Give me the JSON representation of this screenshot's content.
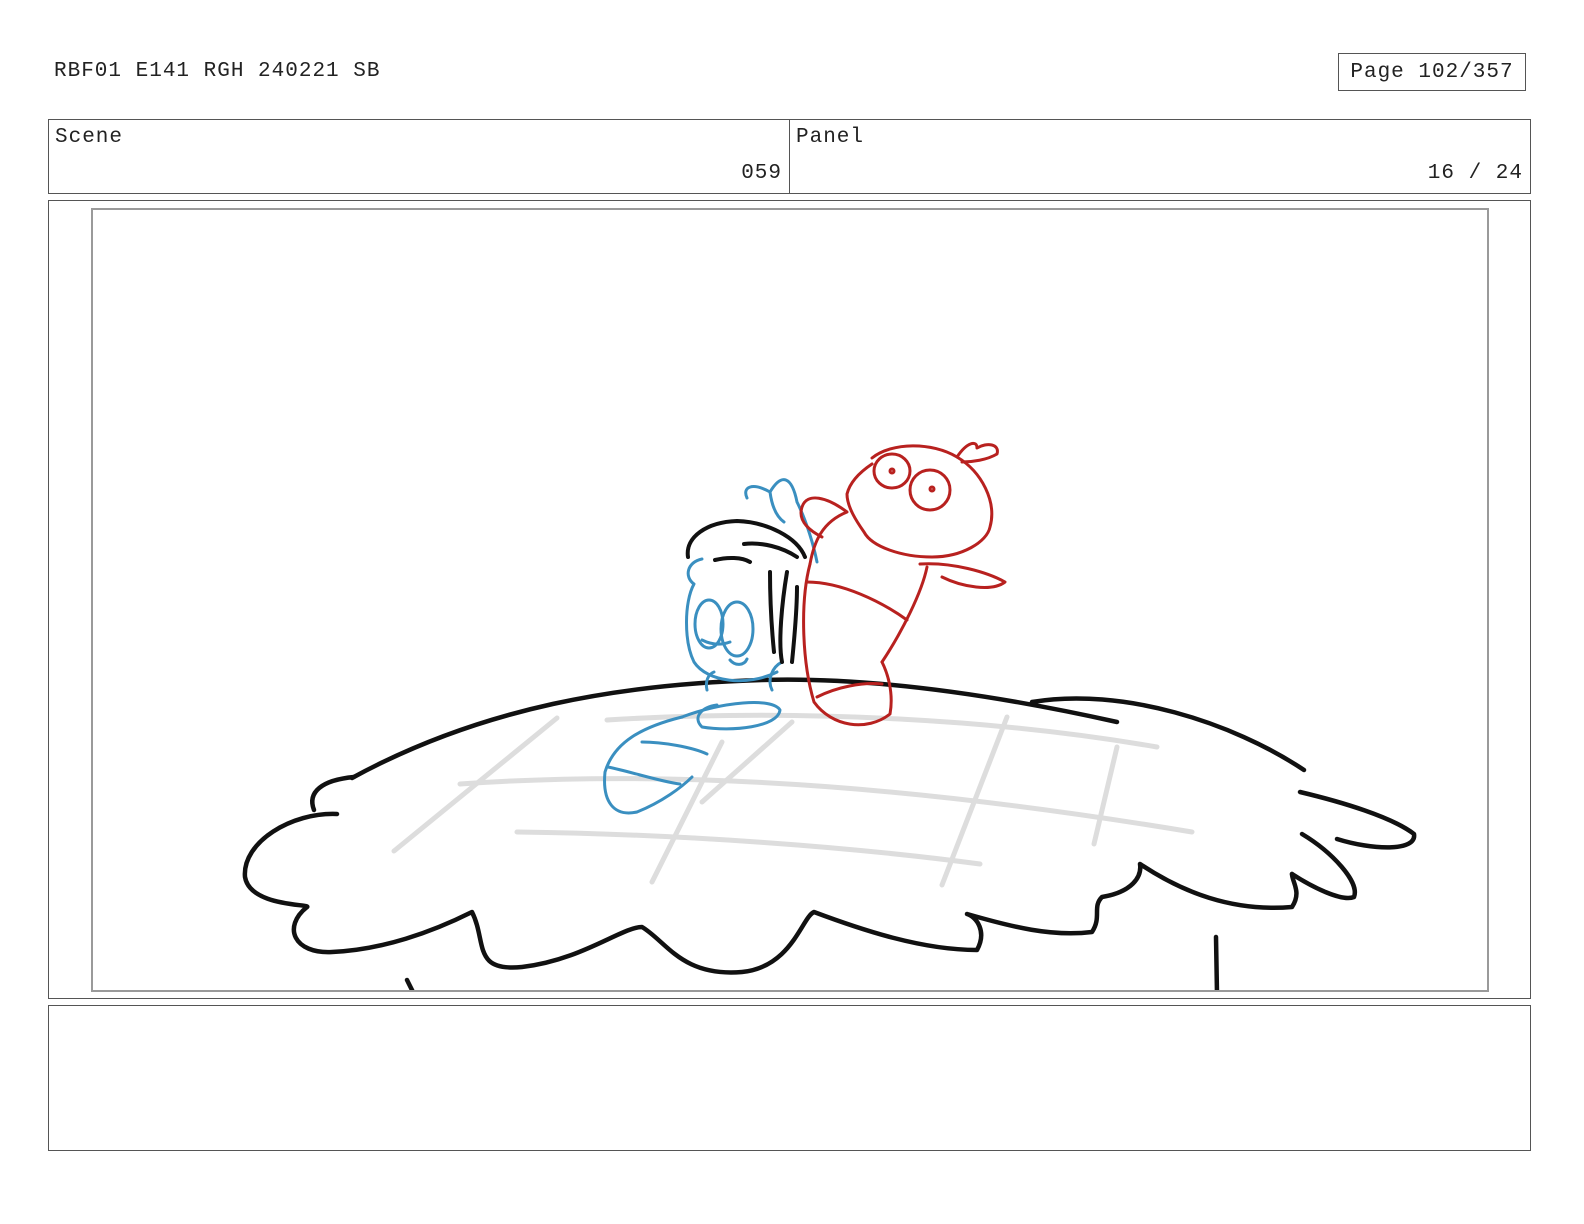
{
  "header": {
    "production_id": "RBF01 E141 RGH 240221 SB",
    "page": "Page 102/357"
  },
  "scene": {
    "label": "Scene",
    "value": "059"
  },
  "panel": {
    "label": "Panel",
    "value": "16 / 24"
  },
  "drawing": {
    "description_colors": {
      "blue_character": "#3a8fc0",
      "red_character": "#b8211f",
      "ink": "#111111",
      "grid": "#dddddd"
    }
  },
  "notes": {
    "text": ""
  }
}
